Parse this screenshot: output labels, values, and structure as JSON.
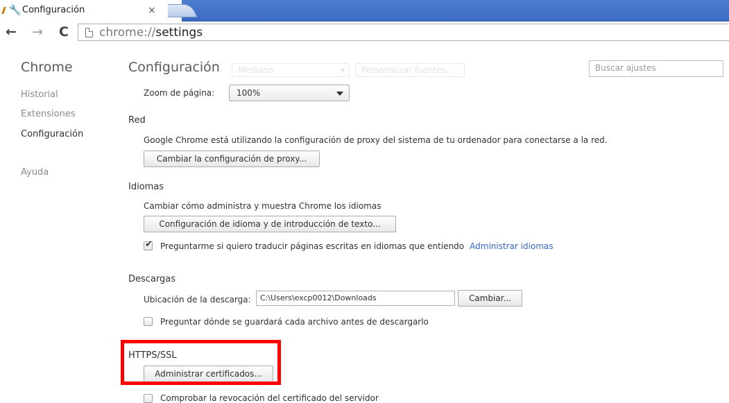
{
  "browser": {
    "tab": {
      "title": "Configuración",
      "icon": "wrench-icon",
      "close_glyph": "×"
    },
    "toolbar": {
      "back_glyph": "←",
      "forward_glyph": "→",
      "reload_glyph": "C",
      "url_scheme": "chrome://",
      "url_path": "settings"
    }
  },
  "sidebar": {
    "title": "Chrome",
    "items": [
      {
        "label": "Historial",
        "selected": false
      },
      {
        "label": "Extensiones",
        "selected": false
      },
      {
        "label": "Configuración",
        "selected": true
      },
      {
        "label": "Ayuda",
        "selected": false
      }
    ]
  },
  "main": {
    "title": "Configuración",
    "faded_font_select": "Mediano",
    "faded_customize_button": "Personalizar fuentes...",
    "search": {
      "placeholder": "Buscar ajustes"
    },
    "zoom": {
      "label": "Zoom de página:",
      "value": "100%"
    },
    "network": {
      "title": "Red",
      "description": "Google Chrome está utilizando la configuración de proxy del sistema de tu ordenador para conectarse a la red.",
      "button": "Cambiar la configuración de proxy..."
    },
    "languages": {
      "title": "Idiomas",
      "description": "Cambiar cómo administra y muestra Chrome los idiomas",
      "button": "Configuración de idioma y de introducción de texto...",
      "translate_checkbox": {
        "label": "Preguntarme si quiero traducir páginas escritas en idiomas que entiendo",
        "checked": true
      },
      "manage_link": "Administrar idiomas"
    },
    "downloads": {
      "title": "Descargas",
      "location_label": "Ubicación de la descarga:",
      "location_value": "C:\\Users\\excp0012\\Downloads",
      "change_button": "Cambiar...",
      "ask_checkbox": {
        "label": "Preguntar dónde se guardará cada archivo antes de descargarlo",
        "checked": false
      }
    },
    "https": {
      "title": "HTTPS/SSL",
      "button": "Administrar certificados...",
      "revocation_checkbox": {
        "label": "Comprobar la revocación del certificado del servidor",
        "checked": false
      }
    }
  },
  "colors": {
    "highlight": "#ff0000",
    "link": "#3366cc",
    "tabstrip": "#3b6cc2"
  }
}
